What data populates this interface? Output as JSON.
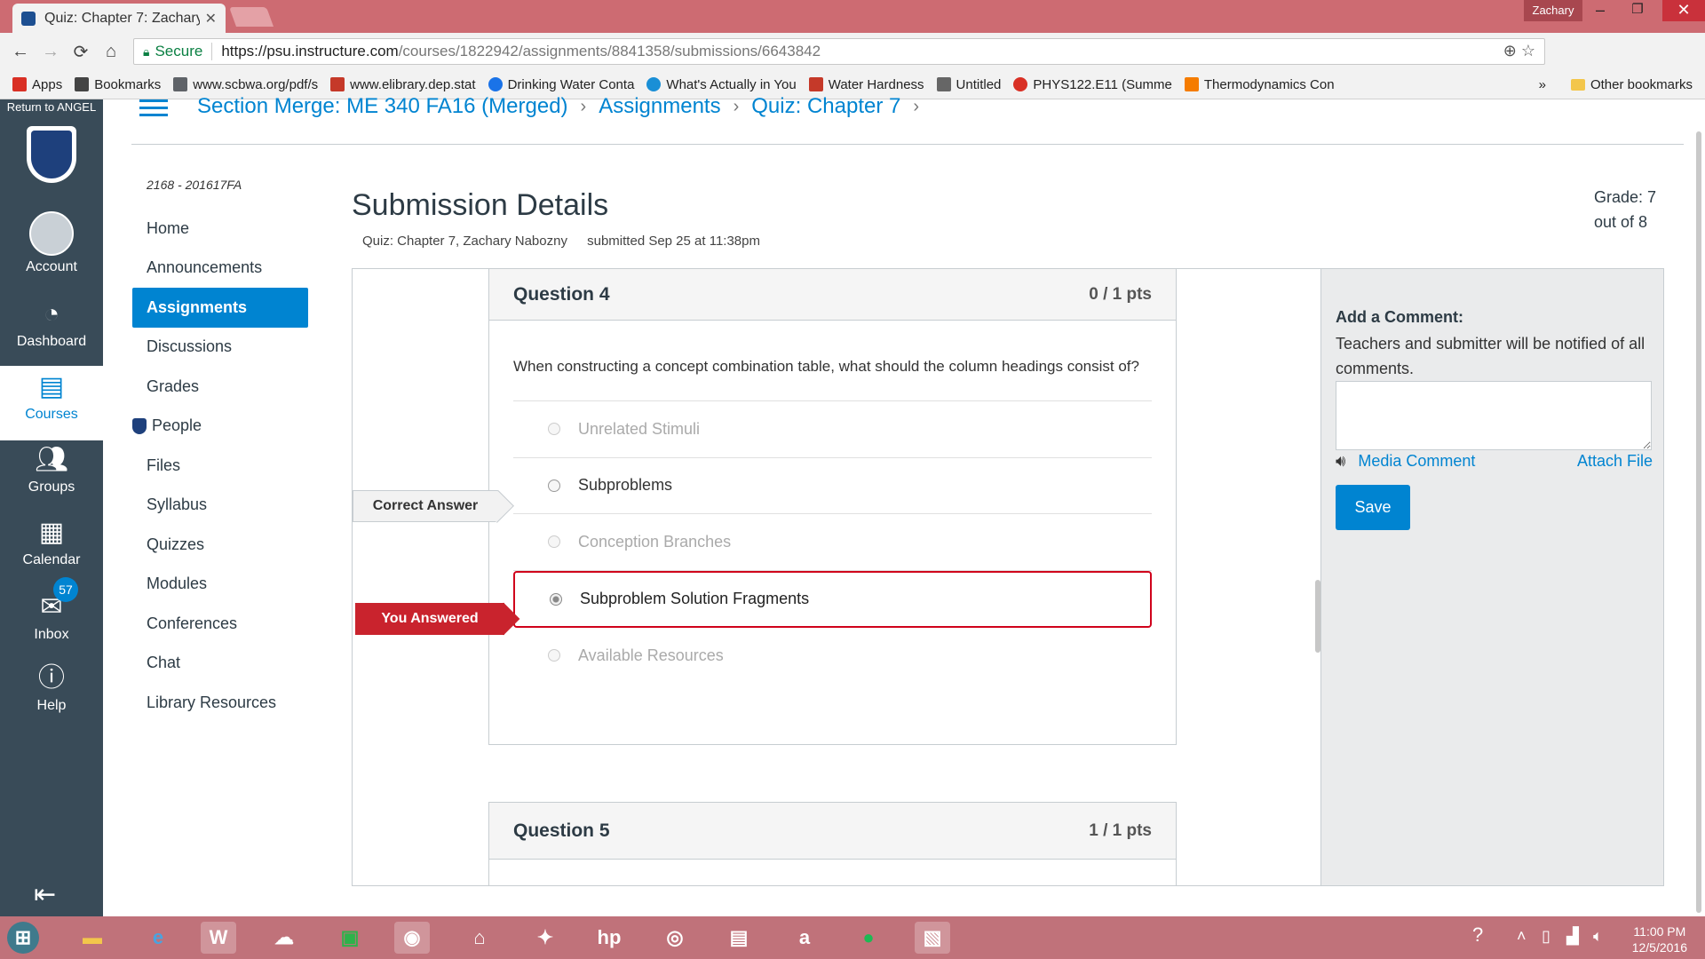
{
  "browser": {
    "tab_title": "Quiz: Chapter 7: Zachary",
    "user": "Zachary",
    "secure_label": "Secure",
    "url_host": "https://psu.instructure.com",
    "url_path": "/courses/1822942/assignments/8841358/submissions/6643842",
    "bookmarks": [
      {
        "label": "Apps",
        "icon": "apps-grid-icon",
        "color": "#d93025"
      },
      {
        "label": "Bookmarks",
        "icon": "star-icon",
        "color": "#444444"
      },
      {
        "label": "www.scbwa.org/pdf/s",
        "icon": "page-icon",
        "color": "#5f6368"
      },
      {
        "label": "www.elibrary.dep.stat",
        "icon": "elibrary-icon",
        "color": "#c53929"
      },
      {
        "label": "Drinking Water Conta",
        "icon": "water-icon",
        "color": "#1a73e8"
      },
      {
        "label": "What's Actually in You",
        "icon": "water-drop-icon",
        "color": "#1a8fd6"
      },
      {
        "label": "Water Hardness",
        "icon": "hardness-icon",
        "color": "#c53929"
      },
      {
        "label": "Untitled",
        "icon": "document-icon",
        "color": "#666666"
      },
      {
        "label": "PHYS122.E11 (Summe",
        "icon": "ring-icon",
        "color": "#d93025"
      },
      {
        "label": "Thermodynamics Con",
        "icon": "thermo-icon",
        "color": "#f57c00"
      }
    ],
    "more": "»",
    "other_bookmarks": "Other bookmarks"
  },
  "global_nav": {
    "logo_text": "Return to ANGEL",
    "items": [
      {
        "label": "Account",
        "icon": "account-icon"
      },
      {
        "label": "Dashboard",
        "icon": "dashboard-icon"
      },
      {
        "label": "Courses",
        "icon": "courses-icon"
      },
      {
        "label": "Groups",
        "icon": "groups-icon"
      },
      {
        "label": "Calendar",
        "icon": "calendar-icon"
      },
      {
        "label": "Inbox",
        "icon": "inbox-icon",
        "badge": "57"
      },
      {
        "label": "Help",
        "icon": "help-icon"
      }
    ]
  },
  "breadcrumbs": [
    "Section Merge: ME 340 FA16 (Merged)",
    "Assignments",
    "Quiz: Chapter 7"
  ],
  "course_nav": {
    "term": "2168 - 201617FA",
    "items": [
      "Home",
      "Announcements",
      "Assignments",
      "Discussions",
      "Grades",
      "People",
      "Files",
      "Syllabus",
      "Quizzes",
      "Modules",
      "Conferences",
      "Chat",
      "Library Resources"
    ],
    "active": "Assignments"
  },
  "submission": {
    "title": "Submission Details",
    "quiz_student": "Quiz: Chapter 7, Zachary Nabozny",
    "submitted": "submitted Sep 25 at 11:38pm",
    "grade_line1": "Grade: 7",
    "grade_line2": "out of 8"
  },
  "question4": {
    "name": "Question 4",
    "points": "0 / 1 pts",
    "text": "When constructing a concept combination table, what should the column headings consist of?",
    "answers": [
      "Unrelated Stimuli",
      "Subproblems",
      "Conception Branches",
      "Subproblem Solution Fragments",
      "Available Resources"
    ],
    "correct_flag": "Correct Answer",
    "wrong_flag": "You Answered"
  },
  "question5": {
    "name": "Question 5",
    "points": "1 / 1 pts"
  },
  "comments": {
    "title": "Add a Comment:",
    "desc": "Teachers and submitter will be notified of all comments.",
    "media": "Media Comment",
    "attach": "Attach File",
    "save": "Save"
  },
  "taskbar": {
    "time": "11:00 PM",
    "date": "12/5/2016"
  },
  "colors": {
    "accent": "#0084d1",
    "nav_bg": "#394b58",
    "wrong": "#d0021b"
  }
}
